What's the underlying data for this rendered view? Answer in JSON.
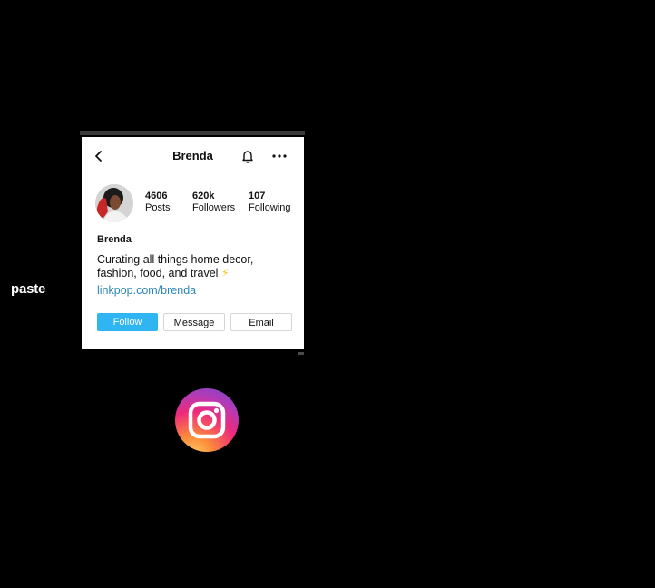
{
  "side_label": "paste",
  "profile": {
    "header_title": "Brenda",
    "stats": [
      {
        "value": "4606",
        "label": "Posts"
      },
      {
        "value": "620k",
        "label": "Followers"
      },
      {
        "value": "107",
        "label": "Following"
      }
    ],
    "name": "Brenda",
    "bio": "Curating all things home decor, fashion, food, and travel",
    "bio_emoji": "⚡",
    "link": "linkpop.com/brenda",
    "buttons": {
      "follow": "Follow",
      "message": "Message",
      "email": "Email"
    }
  },
  "icons": {
    "back": "chevron-left-icon",
    "notifications": "bell-icon",
    "more": "more-horizontal-icon",
    "logo": "instagram-logo-icon"
  },
  "colors": {
    "follow_button": "#2eb5f2",
    "link": "#2a86b8",
    "background": "#000000",
    "card": "#ffffff"
  }
}
